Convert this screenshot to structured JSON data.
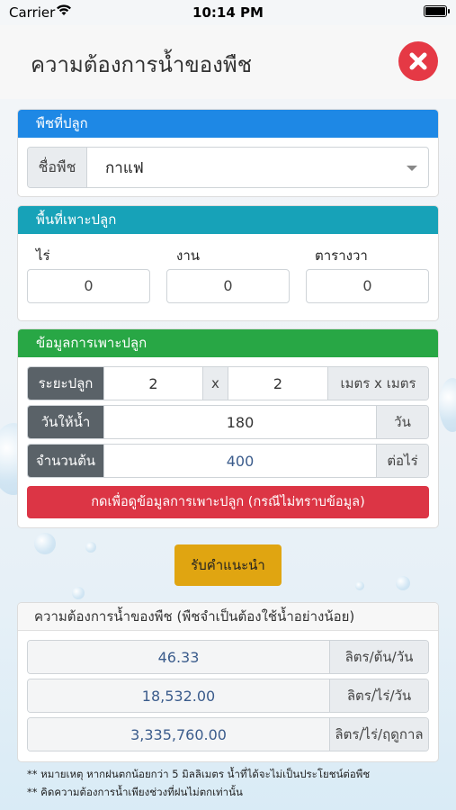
{
  "status": {
    "carrier": "Carrier",
    "time": "10:14 PM"
  },
  "header": {
    "title": "ความต้องการน้ำของพืช",
    "close_icon": "close-icon"
  },
  "crop": {
    "heading": "พืชที่ปลูก",
    "name_label": "ชื่อพืช",
    "selected": "กาแฟ"
  },
  "area": {
    "heading": "พื้นที่เพาะปลูก",
    "rai_label": "ไร่",
    "ngan_label": "งาน",
    "wa_label": "ตารางวา",
    "rai": "0",
    "ngan": "0",
    "wa": "0"
  },
  "planting": {
    "heading": "ข้อมูลการเพาะปลูก",
    "spacing_label": "ระยะปลูก",
    "spacing_a": "2",
    "spacing_x": "x",
    "spacing_b": "2",
    "spacing_unit": "เมตร x เมตร",
    "days_label": "วันให้น้ำ",
    "days": "180",
    "days_unit": "วัน",
    "count_label": "จำนวนต้น",
    "count": "400",
    "count_unit": "ต่อไร่",
    "info_button": "กดเพื่อดูข้อมูลการเพาะปลูก (กรณีไม่ทราบข้อมูล)"
  },
  "advice_button": "รับคำแนะนำ",
  "result": {
    "heading": "ความต้องการน้ำของพืช (พืชจำเป็นต้องใช้น้ำอย่างน้อย)",
    "rows": [
      {
        "value": "46.33",
        "unit": "ลิตร/ต้น/วัน"
      },
      {
        "value": "18,532.00",
        "unit": "ลิตร/ไร่/วัน"
      },
      {
        "value": "3,335,760.00",
        "unit": "ลิตร/ไร่/ฤดูกาล"
      }
    ]
  },
  "notes": [
    "** หมายเหตุ หากฝนตกน้อยกว่า 5 มิลลิเมตร น้ำที่ได้จะไม่เป็นประโยชน์ต่อพืช",
    "** คิดความต้องการน้ำเพียงช่วงที่ฝนไม่ตกเท่านั้น"
  ],
  "colors": {
    "blue_header": "#1e88e5",
    "teal_header": "#17a2b8",
    "green_header": "#28a745",
    "red_button": "#dc3545",
    "yellow_button": "#e0a511",
    "close_button": "#e53945"
  }
}
